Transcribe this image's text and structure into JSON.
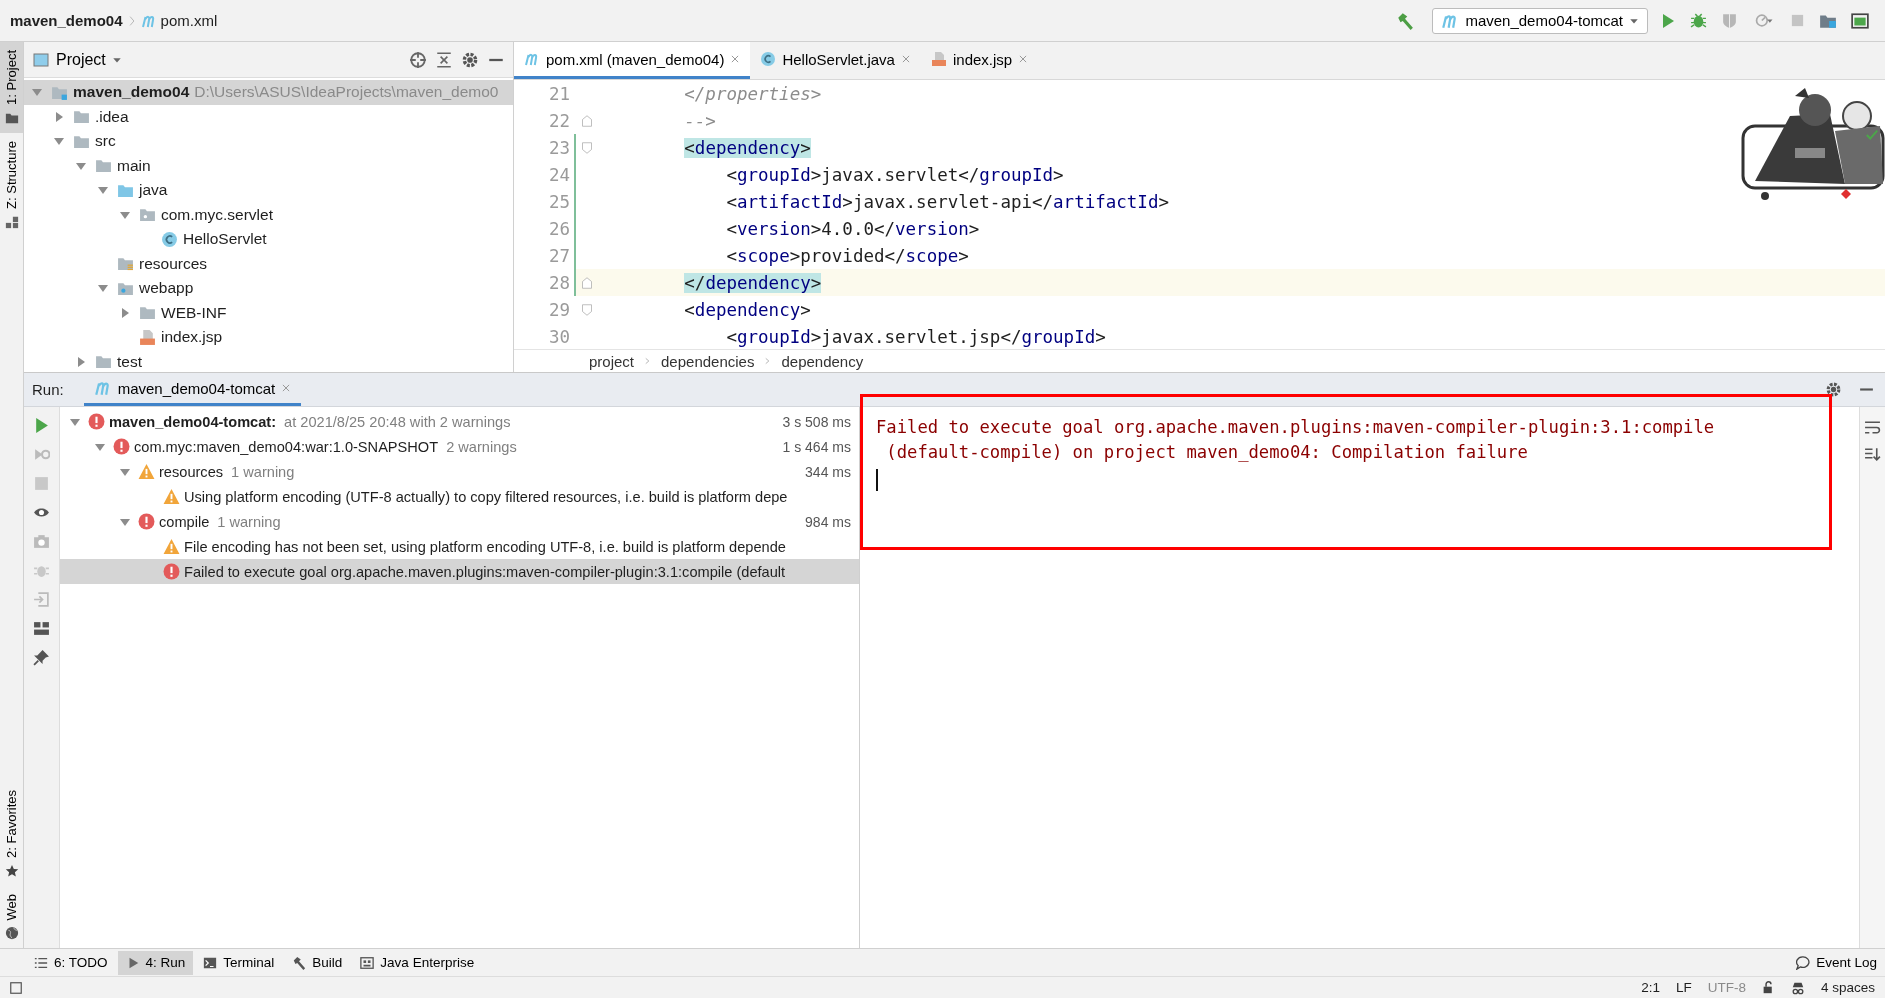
{
  "nav_bar": {
    "breadcrumbs": [
      {
        "label": "maven_demo04",
        "kind": "project"
      },
      {
        "label": "pom.xml",
        "kind": "maven"
      }
    ],
    "run_configuration": "maven_demo04-tomcat"
  },
  "tool_strip": {
    "top": [
      {
        "label": "1: Project",
        "selected": true
      },
      {
        "label": "Z: Structure",
        "selected": false
      }
    ],
    "bottom": [
      {
        "label": "2: Favorites",
        "kind": "star"
      },
      {
        "label": "Web",
        "kind": "globe"
      }
    ]
  },
  "project_panel": {
    "title": "Project",
    "tree": [
      {
        "label": "maven_demo04",
        "hint": "D:\\Users\\ASUS\\IdeaProjects\\maven_demo0",
        "kind": "module",
        "expanded": true,
        "selected": true,
        "children": [
          {
            "label": ".idea",
            "kind": "folder",
            "expanded": false,
            "selected": false
          },
          {
            "label": "src",
            "kind": "folder",
            "expanded": true,
            "selected": false,
            "children": [
              {
                "label": "main",
                "kind": "folder",
                "expanded": true,
                "selected": false,
                "children": [
                  {
                    "label": "java",
                    "kind": "source",
                    "expanded": true,
                    "selected": false,
                    "children": [
                      {
                        "label": "com.myc.servlet",
                        "kind": "package",
                        "expanded": true,
                        "selected": false,
                        "children": [
                          {
                            "label": "HelloServlet",
                            "kind": "class",
                            "selected": false
                          }
                        ]
                      }
                    ]
                  },
                  {
                    "label": "resources",
                    "kind": "resources",
                    "selected": false
                  },
                  {
                    "label": "webapp",
                    "kind": "web",
                    "expanded": true,
                    "selected": false,
                    "children": [
                      {
                        "label": "WEB-INF",
                        "kind": "folder",
                        "expanded": false,
                        "selected": false
                      },
                      {
                        "label": "index.jsp",
                        "kind": "jsp",
                        "selected": false
                      }
                    ]
                  }
                ]
              },
              {
                "label": "test",
                "kind": "folder",
                "expanded": false,
                "selected": false
              }
            ]
          }
        ]
      }
    ]
  },
  "editor": {
    "tabs": [
      {
        "label": "pom.xml (maven_demo04)",
        "kind": "maven",
        "selected": true
      },
      {
        "label": "HelloServlet.java",
        "kind": "class",
        "selected": false
      },
      {
        "label": "index.jsp",
        "kind": "jsp",
        "selected": false
      }
    ],
    "lines": [
      {
        "number": "21",
        "fold_start": false,
        "fold_end": false,
        "changed": false,
        "current": false,
        "brace_match": false,
        "tokens": [
          {
            "kind": "comment",
            "text": "        </properties>"
          }
        ]
      },
      {
        "number": "22",
        "fold_start": false,
        "fold_end": true,
        "changed": false,
        "current": false,
        "brace_match": false,
        "tokens": [
          {
            "kind": "comment",
            "text": "        -->"
          }
        ]
      },
      {
        "number": "23",
        "fold_start": true,
        "fold_end": false,
        "changed": true,
        "current": false,
        "brace_match": true,
        "tokens": [
          {
            "kind": "punct",
            "text": "        <"
          },
          {
            "kind": "tag",
            "text": "dependency"
          },
          {
            "kind": "punct",
            "text": ">"
          }
        ]
      },
      {
        "number": "24",
        "fold_start": false,
        "fold_end": false,
        "changed": true,
        "current": false,
        "brace_match": false,
        "tokens": [
          {
            "kind": "punct",
            "text": "            <"
          },
          {
            "kind": "tag",
            "text": "groupId"
          },
          {
            "kind": "punct",
            "text": ">javax.servlet</"
          },
          {
            "kind": "tag",
            "text": "groupId"
          },
          {
            "kind": "punct",
            "text": ">"
          }
        ]
      },
      {
        "number": "25",
        "fold_start": false,
        "fold_end": false,
        "changed": true,
        "current": false,
        "brace_match": false,
        "tokens": [
          {
            "kind": "punct",
            "text": "            <"
          },
          {
            "kind": "tag",
            "text": "artifactId"
          },
          {
            "kind": "punct",
            "text": ">javax.servlet-api</"
          },
          {
            "kind": "tag",
            "text": "artifactId"
          },
          {
            "kind": "punct",
            "text": ">"
          }
        ]
      },
      {
        "number": "26",
        "fold_start": false,
        "fold_end": false,
        "changed": true,
        "current": false,
        "brace_match": false,
        "tokens": [
          {
            "kind": "punct",
            "text": "            <"
          },
          {
            "kind": "tag",
            "text": "version"
          },
          {
            "kind": "punct",
            "text": ">4.0.0</"
          },
          {
            "kind": "tag",
            "text": "version"
          },
          {
            "kind": "punct",
            "text": ">"
          }
        ]
      },
      {
        "number": "27",
        "fold_start": false,
        "fold_end": false,
        "changed": true,
        "current": false,
        "brace_match": false,
        "tokens": [
          {
            "kind": "punct",
            "text": "            <"
          },
          {
            "kind": "tag",
            "text": "scope"
          },
          {
            "kind": "punct",
            "text": ">provided</"
          },
          {
            "kind": "tag",
            "text": "scope"
          },
          {
            "kind": "punct",
            "text": ">"
          }
        ]
      },
      {
        "number": "28",
        "fold_start": false,
        "fold_end": true,
        "changed": true,
        "current": true,
        "brace_match": true,
        "tokens": [
          {
            "kind": "punct",
            "text": "        </"
          },
          {
            "kind": "tag",
            "text": "dependency"
          },
          {
            "kind": "punct",
            "text": ">"
          }
        ]
      },
      {
        "number": "29",
        "fold_start": true,
        "fold_end": false,
        "changed": false,
        "current": false,
        "brace_match": false,
        "tokens": [
          {
            "kind": "punct",
            "text": "        <"
          },
          {
            "kind": "tag",
            "text": "dependency"
          },
          {
            "kind": "punct",
            "text": ">"
          }
        ]
      },
      {
        "number": "30",
        "fold_start": false,
        "fold_end": false,
        "changed": false,
        "current": false,
        "brace_match": false,
        "tokens": [
          {
            "kind": "punct",
            "text": "            <"
          },
          {
            "kind": "tag",
            "text": "groupId"
          },
          {
            "kind": "punct",
            "text": ">javax.servlet.jsp</"
          },
          {
            "kind": "tag",
            "text": "groupId"
          },
          {
            "kind": "punct",
            "text": ">"
          }
        ]
      }
    ],
    "breadcrumb": [
      "project",
      "dependencies",
      "dependency"
    ]
  },
  "run_panel": {
    "label": "Run:",
    "tabs": [
      {
        "label": "maven_demo04-tomcat",
        "selected": true
      }
    ],
    "tree": [
      {
        "kind": "error",
        "title": "maven_demo04-tomcat:",
        "detail": "at 2021/8/25 20:48 with 2 warnings",
        "duration": "3 s 508 ms",
        "expanded": true,
        "selected": false,
        "children": [
          {
            "kind": "error",
            "title": "com.myc:maven_demo04:war:1.0-SNAPSHOT",
            "detail": "2 warnings",
            "duration": "1 s 464 ms",
            "expanded": true,
            "selected": false,
            "children": [
              {
                "kind": "warning",
                "title": "resources",
                "detail": "1 warning",
                "duration": "344 ms",
                "expanded": true,
                "selected": false,
                "children": [
                  {
                    "kind": "warning",
                    "title": "Using platform encoding (UTF-8 actually) to copy filtered resources, i.e. build is platform depe",
                    "selected": false
                  }
                ]
              },
              {
                "kind": "error",
                "title": "compile",
                "detail": "1 warning",
                "duration": "984 ms",
                "expanded": true,
                "selected": false,
                "children": [
                  {
                    "kind": "warning",
                    "title": "File encoding has not been set, using platform encoding UTF-8, i.e. build is platform depende",
                    "selected": false
                  },
                  {
                    "kind": "error",
                    "title": "Failed to execute goal org.apache.maven.plugins:maven-compiler-plugin:3.1:compile (default",
                    "selected": true
                  }
                ]
              }
            ]
          }
        ]
      }
    ],
    "console": {
      "lines": [
        "Failed to execute goal org.apache.maven.plugins:maven-compiler-plugin:3.1:compile",
        " (default-compile) on project maven_demo04: Compilation failure"
      ]
    }
  },
  "tool_windows": [
    {
      "label": "6: TODO",
      "kind": "list",
      "selected": false
    },
    {
      "label": "4: Run",
      "kind": "run",
      "selected": true
    },
    {
      "label": "Terminal",
      "kind": "terminal",
      "selected": false
    },
    {
      "label": "Build",
      "kind": "hammer",
      "selected": false
    },
    {
      "label": "Java Enterprise",
      "kind": "enterprise",
      "selected": false
    }
  ],
  "event_log": "Event Log",
  "status_bar": {
    "position": "2:1",
    "line_separator": "LF",
    "encoding": "UTF-8",
    "indent": "4 spaces"
  }
}
